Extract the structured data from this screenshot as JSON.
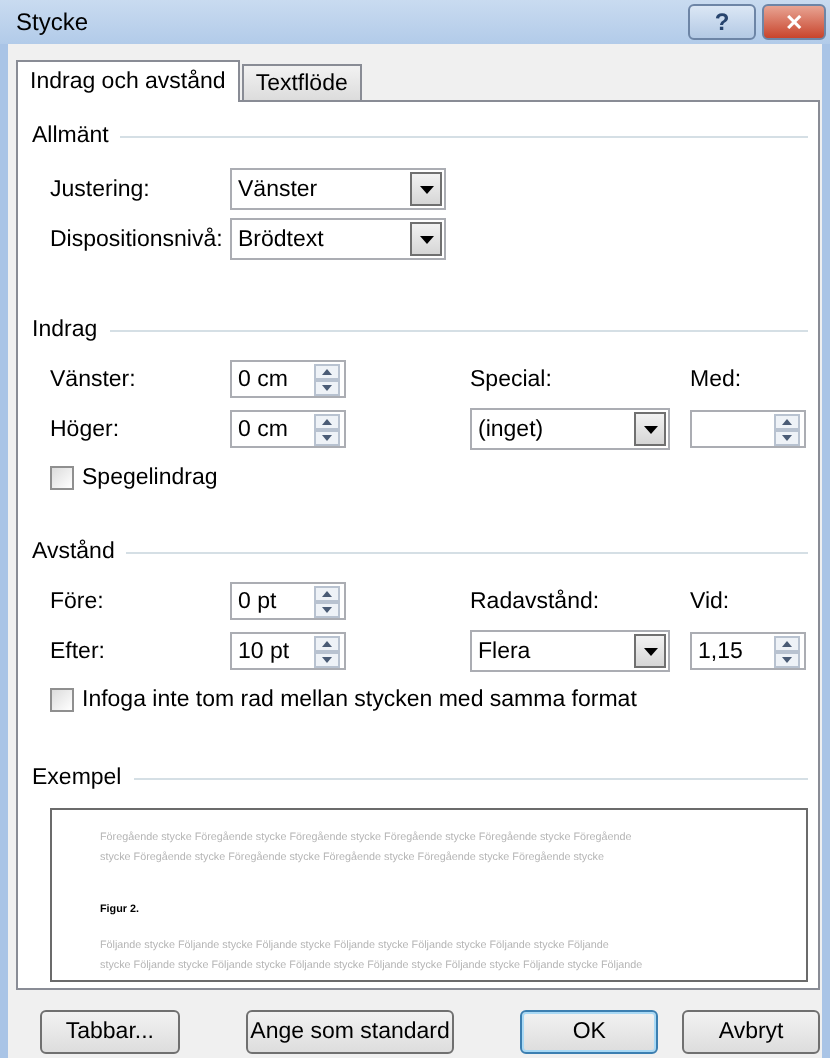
{
  "window": {
    "title": "Stycke"
  },
  "title_buttons": [
    {
      "kind": "help",
      "label": "?"
    },
    {
      "kind": "close",
      "label": "✕"
    }
  ],
  "tabs": [
    {
      "label": "Indrag och avstånd",
      "selected": true
    },
    {
      "label": "Textflöde",
      "selected": false
    }
  ],
  "general": {
    "heading": "Allmänt",
    "fields": [
      {
        "label": "Justering:",
        "value": "Vänster"
      },
      {
        "label": "Dispositionsnivå:",
        "value": "Brödtext"
      }
    ]
  },
  "indentation": {
    "heading": "Indrag",
    "left": {
      "label": "Vänster:",
      "value": "0 cm"
    },
    "right": {
      "label": "Höger:",
      "value": "0 cm"
    },
    "special": {
      "label": "Special:",
      "value": "(inget)"
    },
    "by": {
      "label": "Med:"
    },
    "mirror": {
      "label": "Spegelindrag",
      "checked": false
    }
  },
  "spacing": {
    "heading": "Avstånd",
    "before": {
      "label": "Före:",
      "value": "0 pt"
    },
    "after": {
      "label": "Efter:",
      "value": "10 pt"
    },
    "line_spacing": {
      "label": "Radavstånd:",
      "value": "Flera"
    },
    "at": {
      "label": "Vid:",
      "value": "1,15"
    },
    "no_space": {
      "label": "Infoga inte tom rad mellan stycken med samma format",
      "checked": false
    }
  },
  "preview": {
    "heading": "Exempel",
    "previous": [
      "Föregående stycke Föregående stycke Föregående stycke Föregående stycke Föregående stycke Föregående",
      "stycke Föregående stycke Föregående stycke Föregående stycke Föregående stycke Föregående stycke"
    ],
    "current": "Figur 2.",
    "following": [
      "Följande stycke Följande stycke Följande stycke Följande stycke Följande stycke Följande stycke Följande",
      "stycke Följande stycke Följande stycke Följande stycke Följande stycke Följande stycke Följande stycke Följande"
    ]
  },
  "buttons": [
    {
      "label": "Tabbar...",
      "default": false
    },
    {
      "label": "Ange som standard",
      "default": false
    },
    {
      "label": "OK",
      "default": true
    },
    {
      "label": "Avbryt",
      "default": false
    }
  ]
}
